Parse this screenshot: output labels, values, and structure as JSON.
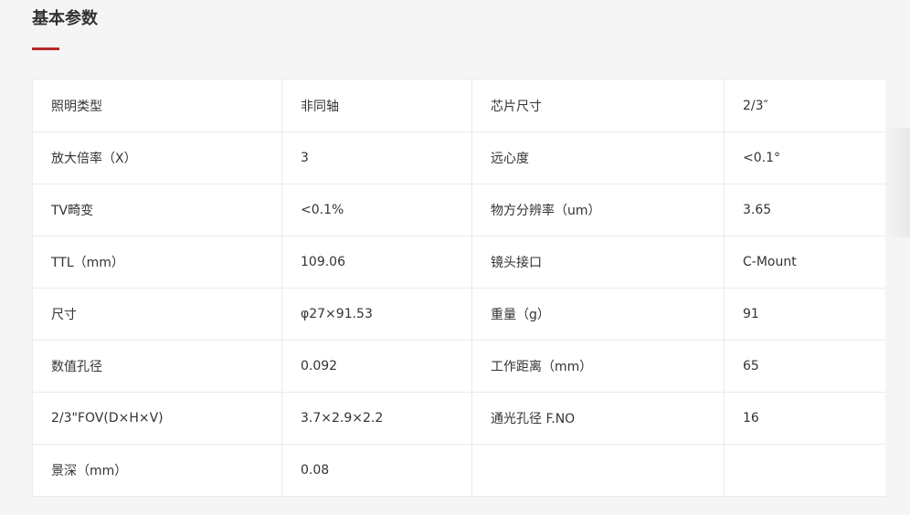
{
  "section": {
    "title": "基本参数"
  },
  "colors": {
    "accent": "#b52a2a",
    "border": "#ebebeb",
    "text": "#333333"
  },
  "rows": [
    {
      "label1": "照明类型",
      "value1": "非同轴",
      "label2": "芯片尺寸",
      "value2": "2/3″"
    },
    {
      "label1": "放大倍率（X）",
      "value1": "3",
      "label2": "远心度",
      "value2": "<0.1°"
    },
    {
      "label1": "TV畸变",
      "value1": "<0.1%",
      "label2": "物方分辨率（um）",
      "value2": "3.65"
    },
    {
      "label1": "TTL（mm）",
      "value1": "109.06",
      "label2": "镜头接口",
      "value2": "C-Mount"
    },
    {
      "label1": "尺寸",
      "value1": "φ27×91.53",
      "label2": "重量（g）",
      "value2": "91"
    },
    {
      "label1": "数值孔径",
      "value1": "0.092",
      "label2": "工作距离（mm）",
      "value2": "65"
    },
    {
      "label1": "2/3\"FOV(D×H×V)",
      "value1": "3.7×2.9×2.2",
      "label2": "通光孔径 F.NO",
      "value2": "16"
    },
    {
      "label1": "景深（mm）",
      "value1": "0.08",
      "label2": "",
      "value2": ""
    }
  ]
}
